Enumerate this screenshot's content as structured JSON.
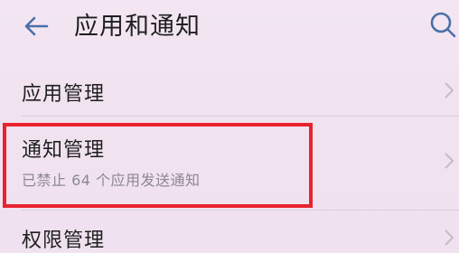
{
  "header": {
    "title": "应用和通知",
    "back_icon": "arrow-left-icon",
    "search_icon": "search-icon"
  },
  "items": [
    {
      "label": "应用管理",
      "subtitle": ""
    },
    {
      "label": "通知管理",
      "subtitle": "已禁止 64 个应用发送通知"
    },
    {
      "label": "权限管理",
      "subtitle": ""
    }
  ],
  "colors": {
    "background": "#f1e4f0",
    "highlight": "#e8232d",
    "accent": "#4a6fa8",
    "secondary_text": "#8c8893"
  }
}
